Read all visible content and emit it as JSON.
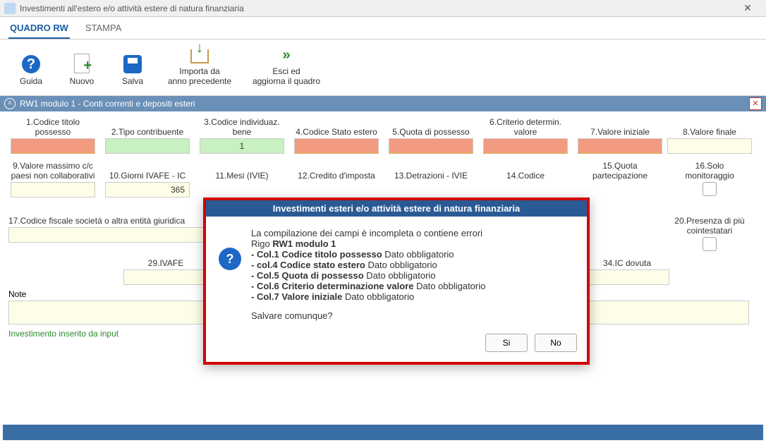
{
  "window": {
    "title": "Investimenti all'estero e/o attività estere di natura finanziaria"
  },
  "tabs": {
    "active": "QUADRO RW",
    "other": "STAMPA"
  },
  "ribbon": {
    "guida": "Guida",
    "nuovo": "Nuovo",
    "salva": "Salva",
    "importa": "Importa da\nanno precedente",
    "esci": "Esci ed\naggiorna il quadro"
  },
  "sectionHeader": "RW1 modulo 1 - Conti correnti e depositi esteri",
  "fields": {
    "c1": "1.Codice titolo possesso",
    "c2": "2.Tipo contribuente",
    "c3": "3.Codice individuaz. bene",
    "c3v": "1",
    "c4": "4.Codice Stato estero",
    "c5": "5.Quota di possesso",
    "c6": "6.Criterio determin. valore",
    "c7": "7.Valore iniziale",
    "c8": "8.Valore finale",
    "c9": "9.Valore massimo c/c paesi non collaborativi",
    "c10": "10.Giorni IVAFE - IC",
    "c10v": "365",
    "c11": "11.Mesi (IVIE)",
    "c12": "12.Credito d'imposta",
    "c13": "13.Detrazioni - IVIE",
    "c14": "14.Codice",
    "c15": "15.Quota partecipazione",
    "c16": "16.Solo monitoraggio",
    "c17": "17.Codice fiscale società o altra entità giuridica",
    "c20": "20.Presenza di più cointestatari",
    "c29": "29.IVAFE",
    "c34": "34.IC dovuta"
  },
  "note": {
    "label": "Note"
  },
  "status": "Investimento inserito da input",
  "dialog": {
    "title": "Investimenti esteri e/o attività estere di natura finanziaria",
    "line1": "La compilazione dei campi è incompleta o contiene errori",
    "line2": "Rigo RW1 modulo 1",
    "e1b": "- Col.1 Codice titolo possesso",
    "e1t": " Dato obbligatorio",
    "e2b": "- col.4 Codice stato estero",
    "e2t": " Dato obbligatorio",
    "e3b": "- Col.5 Quota di possesso",
    "e3t": " Dato obbligatorio",
    "e4b": "- Col.6 Criterio determinazione valore",
    "e4t": " Dato obbligatorio",
    "e5b": "- Col.7 Valore iniziale",
    "e5t": " Dato obbligatorio",
    "prompt": "Salvare comunque?",
    "yes": "Si",
    "no": "No"
  }
}
